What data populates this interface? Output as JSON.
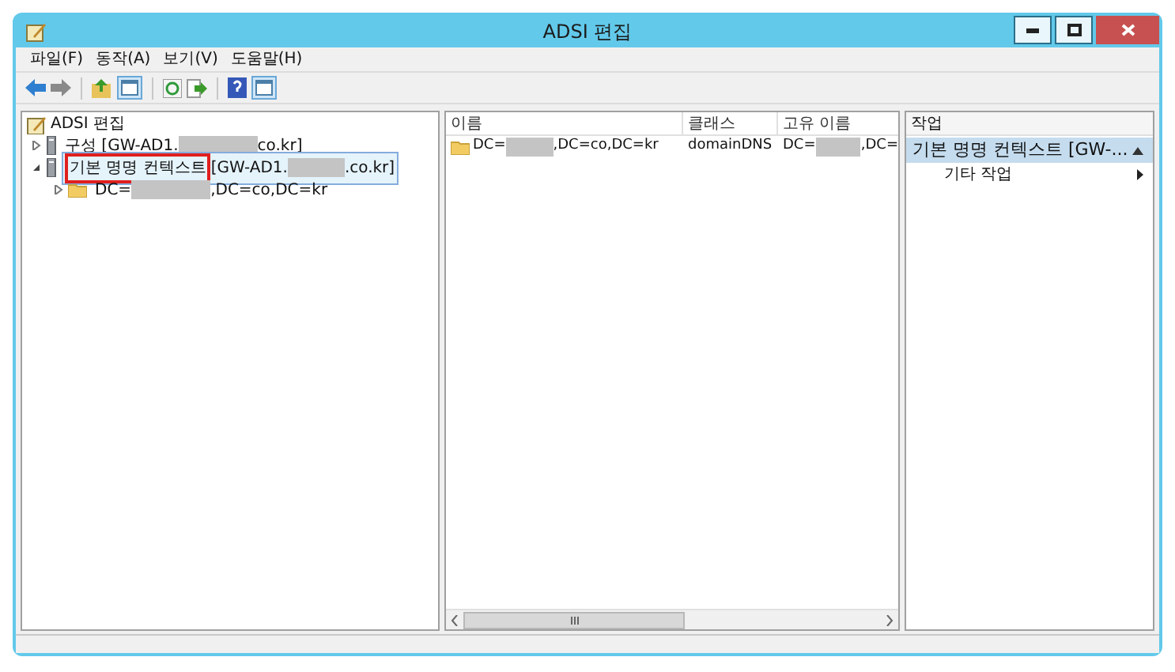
{
  "window": {
    "title": "ADSI 편집"
  },
  "menu": [
    "파일(F)",
    "동작(A)",
    "보기(V)",
    "도움말(H)"
  ],
  "tree": {
    "label": "ADSI 편집",
    "children": [
      {
        "parts": [
          "구성 [GW-AD1.",
          "co.kr]"
        ],
        "expanded": false,
        "selected": false
      },
      {
        "parts": [
          "기본 명명 컨텍스트",
          " [GW-AD1.",
          ".co.kr]"
        ],
        "first_part_boxed": true,
        "expanded": true,
        "selected": true,
        "children": [
          {
            "parts": [
              "DC=",
              ",DC=co,DC=kr"
            ],
            "expanded": false,
            "selected": false
          }
        ]
      }
    ]
  },
  "list": {
    "columns": [
      "이름",
      "클래스",
      "고유 이름"
    ],
    "rows": [
      {
        "name": [
          "DC=",
          ",DC=co,DC=kr"
        ],
        "class": "domainDNS",
        "distinguished": [
          "DC=",
          ",DC="
        ]
      }
    ]
  },
  "actions": {
    "header": "작업",
    "section": "기본 명명 컨텍스트 [GW-...",
    "items": [
      "기타 작업"
    ]
  }
}
